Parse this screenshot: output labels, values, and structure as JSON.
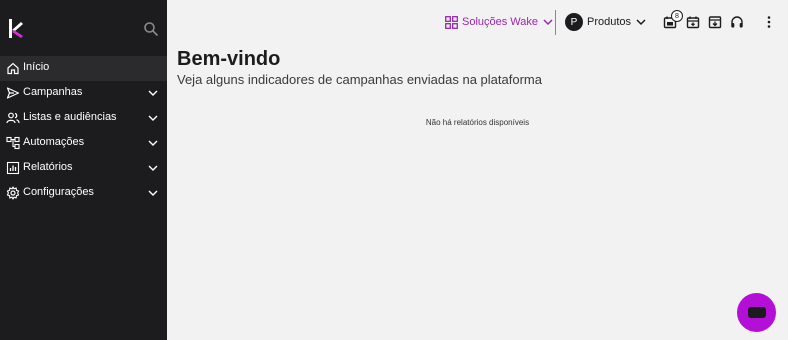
{
  "sidebar": {
    "logo": "wake-logo",
    "items": [
      {
        "label": "Início",
        "icon": "home-icon",
        "active": true,
        "has_submenu": false
      },
      {
        "label": "Campanhas",
        "icon": "send-icon",
        "active": false,
        "has_submenu": true
      },
      {
        "label": "Listas e audiências",
        "icon": "users-icon",
        "active": false,
        "has_submenu": true
      },
      {
        "label": "Automações",
        "icon": "flow-icon",
        "active": false,
        "has_submenu": true
      },
      {
        "label": "Relatórios",
        "icon": "chart-icon",
        "active": false,
        "has_submenu": true
      },
      {
        "label": "Configurações",
        "icon": "gear-icon",
        "active": false,
        "has_submenu": true
      }
    ]
  },
  "topbar": {
    "solucoes_label": "Soluções Wake",
    "avatar_letter": "P",
    "produtos_label": "Produtos",
    "notification_count": "8"
  },
  "main": {
    "title": "Bem-vindo",
    "subtitle": "Veja alguns indicadores de campanhas enviadas na plataforma",
    "empty_message": "Não há relatórios disponíveis"
  },
  "colors": {
    "sidebar_bg": "#1c1c1e",
    "accent": "#9b27b0",
    "fab": "#b40fd6",
    "page_bg": "#f2f2f2"
  }
}
